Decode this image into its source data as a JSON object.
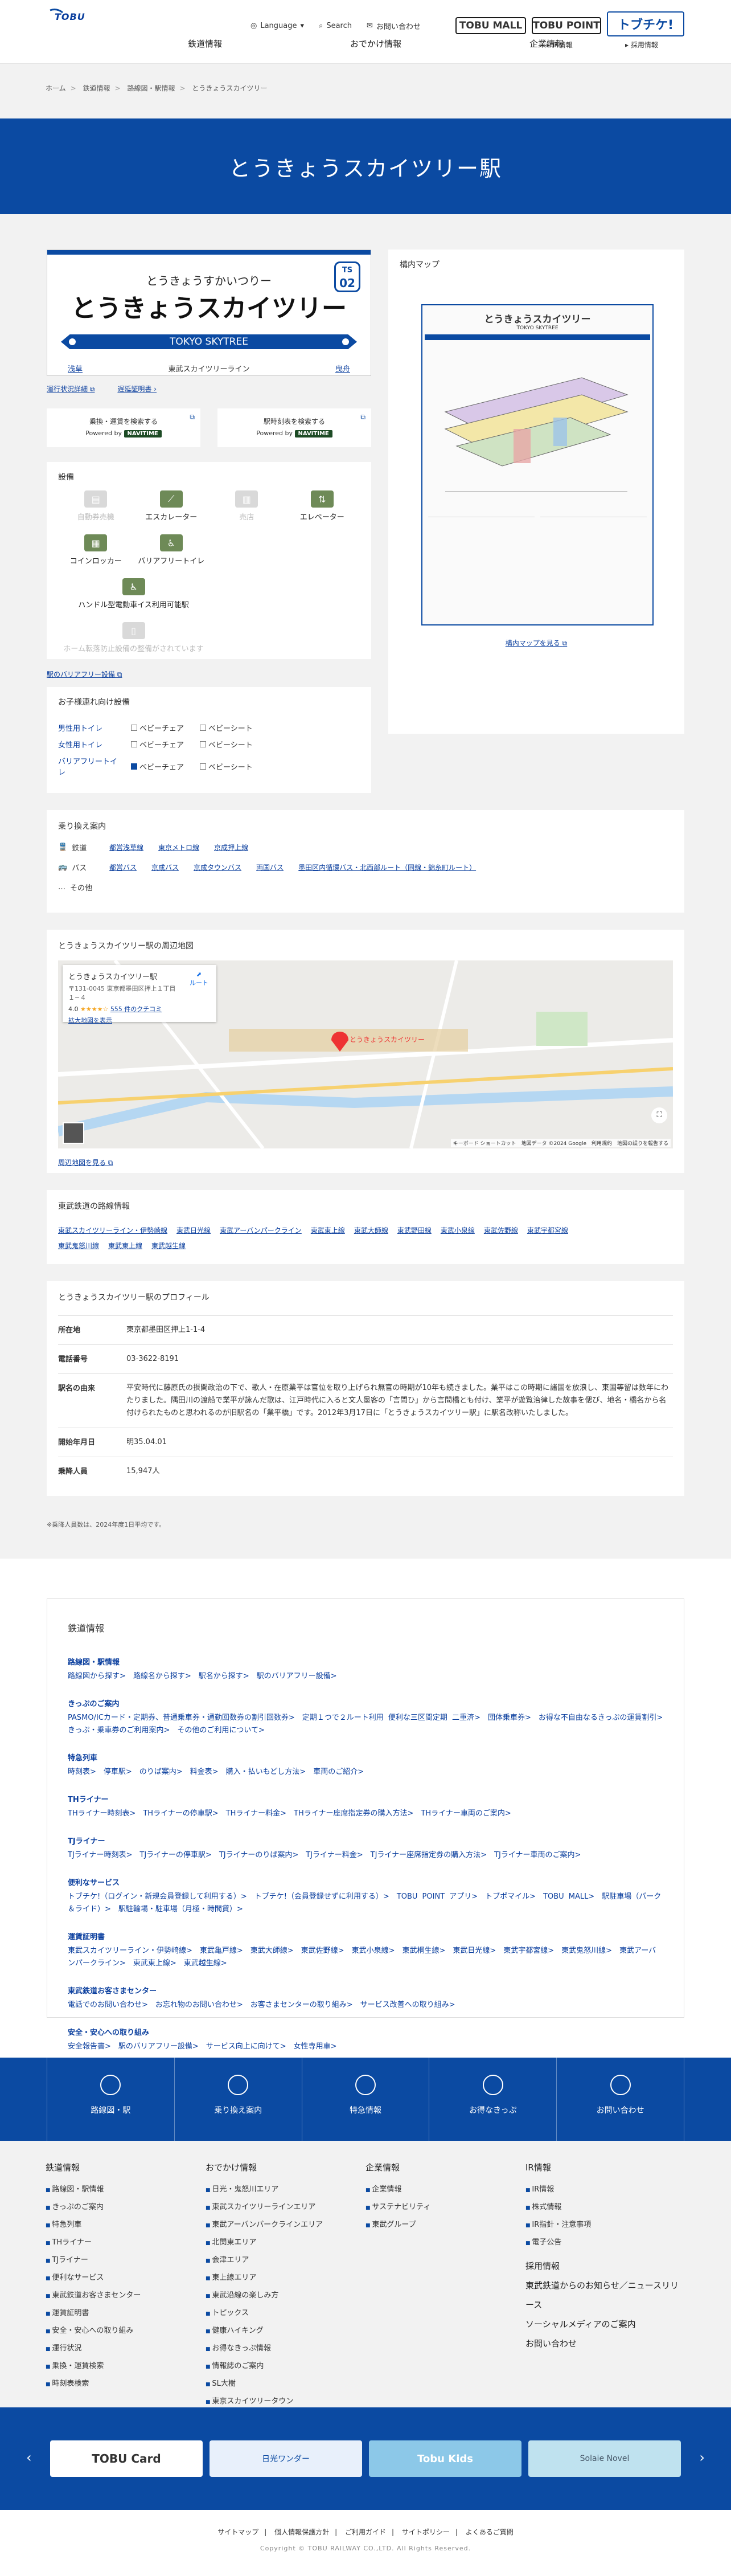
{
  "header": {
    "logo": "TOBU",
    "utils": {
      "language": "Language",
      "search": "Search",
      "contact": "お問い合わせ"
    },
    "nav": [
      "鉄道情報",
      "おでかけ情報",
      "企業情報"
    ],
    "ir": "IR情報",
    "recruit": "採用情報",
    "btn_mall": "TOBU MALL",
    "btn_point": "TOBU POINT",
    "btn_tobu": "トブチケ!"
  },
  "breadcrumb": [
    "ホーム",
    "鉄道情報",
    "路線図・駅情報",
    "とうきょうスカイツリー"
  ],
  "page_title": "とうきょうスカイツリー駅",
  "sign": {
    "kana": "とうきょうすかいつりー",
    "kanji": "とうきょうスカイツリー",
    "number_line": "TS",
    "number": "02",
    "roman": "TOKYO SKYTREE",
    "prev": "浅草",
    "line": "東武スカイツリーライン",
    "next": "曳舟"
  },
  "status_links": {
    "operation": "運行状況詳細",
    "delay_cert": "遅延証明書"
  },
  "search_boxes": [
    {
      "label": "乗換・運賃を検索する",
      "powered": "Powered by",
      "brand": "NAVITIME"
    },
    {
      "label": "駅時刻表を検索する",
      "powered": "Powered by",
      "brand": "NAVITIME"
    }
  ],
  "facilities": {
    "title": "設備",
    "items": [
      {
        "label": "自動券売機",
        "off": true
      },
      {
        "label": "エスカレーター",
        "off": false
      },
      {
        "label": "売店",
        "off": true
      },
      {
        "label": "エレベーター",
        "off": false
      },
      {
        "label": "コインロッカー",
        "off": false
      },
      {
        "label": "バリアフリートイレ",
        "off": false
      },
      {
        "label": "ハンドル型電動車イス利用可能駅",
        "off": false
      },
      {
        "label": "",
        "off": false
      },
      {
        "label": "ホーム転落防止設備の整備がされています",
        "off": true
      }
    ],
    "barrier_free_link": "駅のバリアフリー設備"
  },
  "toilet": {
    "title": "お子様連れ向け設備",
    "rows": [
      {
        "label": "男性用トイレ",
        "chair": "ベビーチェア",
        "sheet": "ベビーシート",
        "chair_on": false,
        "sheet_on": false
      },
      {
        "label": "女性用トイレ",
        "chair": "ベビーチェア",
        "sheet": "ベビーシート",
        "chair_on": false,
        "sheet_on": false
      },
      {
        "label": "バリアフリートイレ",
        "chair": "ベビーチェア",
        "sheet": "ベビーシート",
        "chair_on": true,
        "sheet_on": false
      }
    ]
  },
  "floor_map": {
    "title": "構内マップ",
    "map_title": "とうきょうスカイツリー",
    "map_sub": "TOKYO SKYTREE",
    "link": "構内マップを見る"
  },
  "transfer": {
    "title": "乗り換え案内",
    "rail_label": "鉄道",
    "rail": [
      "都営浅草線",
      "東京メトロ線",
      "京成押上線"
    ],
    "bus_label": "バス",
    "bus": [
      "都営バス",
      "京成バス",
      "京成タウンバス",
      "両国バス",
      "墨田区内循環バス・北西部ルート（同線・錦糸町ルート）"
    ],
    "other": "その他"
  },
  "nearby": {
    "title": "とうきょうスカイツリー駅の周辺地図",
    "popup_name": "とうきょうスカイツリー駅",
    "popup_addr": "〒131-0045 東京都墨田区押上１丁目１−４",
    "popup_rating": "4.0",
    "popup_reviews": "555 件のクチコミ",
    "popup_enlarge": "拡大地図を表示",
    "route": "ルート",
    "pin_label": "とうきょうスカイツリー",
    "map_footer": "キーボード ショートカット　地図データ ©2024 Google　利用規約　地図の誤りを報告する",
    "link": "周辺地図を見る"
  },
  "routes": {
    "title": "東武鉄道の路線情報",
    "links": [
      "東武スカイツリーライン・伊勢崎線",
      "東武日光線",
      "東武アーバンパークライン",
      "東武東上線",
      "東武大師線",
      "東武野田線",
      "東武小泉線",
      "東武佐野線",
      "東武宇都宮線",
      "東武鬼怒川線",
      "東武東上線",
      "東武越生線"
    ]
  },
  "profile": {
    "title": "とうきょうスカイツリー駅のプロフィール",
    "rows": [
      {
        "k": "所在地",
        "v": "東京都墨田区押上1-1-4"
      },
      {
        "k": "電話番号",
        "v": "03-3622-8191"
      },
      {
        "k": "駅名の由来",
        "v": "平安時代に藤原氏の摂関政治の下で、歌人・在原業平は官位を取り上げられ無官の時期が10年も続きました。業平はこの時期に諸国を放浪し、東国等留は数年にわたりました。隅田川の渡船で業平が詠んだ歌は、江戸時代に入ると文人墨客の「言問ひ」から言問橋とも付け、業平が遊覧治律した故事を偲び、地名・橋名から名付けられたものと思われるのが旧駅名の「業平橋」です。2012年3月17日に「とうきょうスカイツリー駅」に駅名改称いたしました。"
      },
      {
        "k": "開始年月日",
        "v": "明35.04.01"
      },
      {
        "k": "乗降人員",
        "v": "15,947人"
      }
    ],
    "note": "※乗降人員数は、2024年度1日平均です。"
  },
  "sitemap": {
    "title": "鉄道情報",
    "sections": [
      {
        "t": "路線図・駅情報",
        "l": "路線図から探す>　路線名から探す>　駅名から探す>　駅のバリアフリー設備>"
      },
      {
        "t": "きっぷのご案内",
        "l": "PASMO/ICカード・定期券、普通乗車券・通勤回数券の割引回数券>　定期１つで２ルート利用 便利な三区間定期 二重済>　団体乗車券>　お得な不自由なるきっぷの運賃割引>　きっぷ・乗車券のご利用案内>　その他のご利用について>"
      },
      {
        "t": "特急列車",
        "l": "時刻表>　停車駅>　のりば案内>　料金表>　購入・払いもどし方法>　車両のご紹介>"
      },
      {
        "t": "THライナー",
        "l": "THライナー時刻表>　THライナーの停車駅>　THライナー料金>　THライナー座席指定券の購入方法>　THライナー車両のご案内>"
      },
      {
        "t": "TJライナー",
        "l": "TJライナー時刻表>　TJライナーの停車駅>　TJライナーのりば案内>　TJライナー料金>　TJライナー座席指定券の購入方法>　TJライナー車両のご案内>"
      },
      {
        "t": "便利なサービス",
        "l": "トブチケ!（ログイン・新規会員登録して利用する）>　トブチケ!（会員登録せずに利用する）>　TOBU POINT アプリ>　トブポマイル>　TOBU MALL>　駅駐車場（パーク＆ライド）>　駅駐輪場・駐車場（月極・時間貸）>"
      },
      {
        "t": "運賃証明書",
        "l": "東武スカイツリーライン・伊勢崎線>　東武亀戸線>　東武大師線>　東武佐野線>　東武小泉線>　東武桐生線>　東武日光線>　東武宇都宮線>　東武鬼怒川線>　東武アーバンパークライン>　東武東上線>　東武越生線>"
      },
      {
        "t": "東武鉄道お客さまセンター",
        "l": "電話でのお問い合わせ>　お忘れ物のお問い合わせ>　お客さまセンターの取り組み>　サービス改善への取り組み>"
      },
      {
        "t": "安全・安心への取り組み",
        "l": "安全報告書>　駅のバリアフリー設備>　サービス向上に向けて>　女性専用車>"
      }
    ]
  },
  "bottom_nav": [
    "路線図・駅",
    "乗り換え案内",
    "特急情報",
    "お得なきっぷ",
    "お問い合わせ"
  ],
  "footer": {
    "col1": {
      "h": "鉄道情報",
      "items": [
        "路線図・駅情報",
        "きっぷのご案内",
        "特急列車",
        "THライナー",
        "TJライナー",
        "便利なサービス",
        "東武鉄道お客さまセンター",
        "運賃証明書",
        "安全・安心への取り組み",
        "運行状況",
        "乗換・運賃検索",
        "時刻表検索"
      ]
    },
    "col2": {
      "h": "おでかけ情報",
      "items": [
        "日光・鬼怒川エリア",
        "東武スカイツリーラインエリア",
        "東武アーバンパークラインエリア",
        "北関東エリア",
        "会津エリア",
        "東上線エリア",
        "東武沿線の楽しみ方",
        "トピックス",
        "健康ハイキング",
        "お得なきっぷ情報",
        "情報誌のご案内",
        "SL大樹",
        "東京スカイツリータウン"
      ]
    },
    "col3": {
      "h": "企業情報",
      "items": [
        "企業情報",
        "サステナビリティ",
        "東武グループ"
      ]
    },
    "col4": {
      "h": "IR情報",
      "items": [
        "IR情報",
        "株式情報",
        "IR指針・注意事項",
        "電子公告"
      ],
      "big": [
        "採用情報",
        "東武鉄道からのお知らせ／ニュースリリース",
        "ソーシャルメディアのご案内",
        "お問い合わせ"
      ]
    }
  },
  "banners": [
    "TOBU Card",
    "日光ワンダー",
    "Tobu Kids",
    "Solaie Novel"
  ],
  "bottom_links": [
    "サイトマップ",
    "個人情報保護方針",
    "ご利用ガイド",
    "サイトポリシー",
    "よくあるご質問"
  ],
  "copyright": "Copyright © TOBU RAILWAY CO.,LTD. All Rights Reserved.",
  "colors": {
    "brand": "#0b4aa2",
    "link": "#0b3f9e",
    "navitime": "#1d4b25"
  }
}
